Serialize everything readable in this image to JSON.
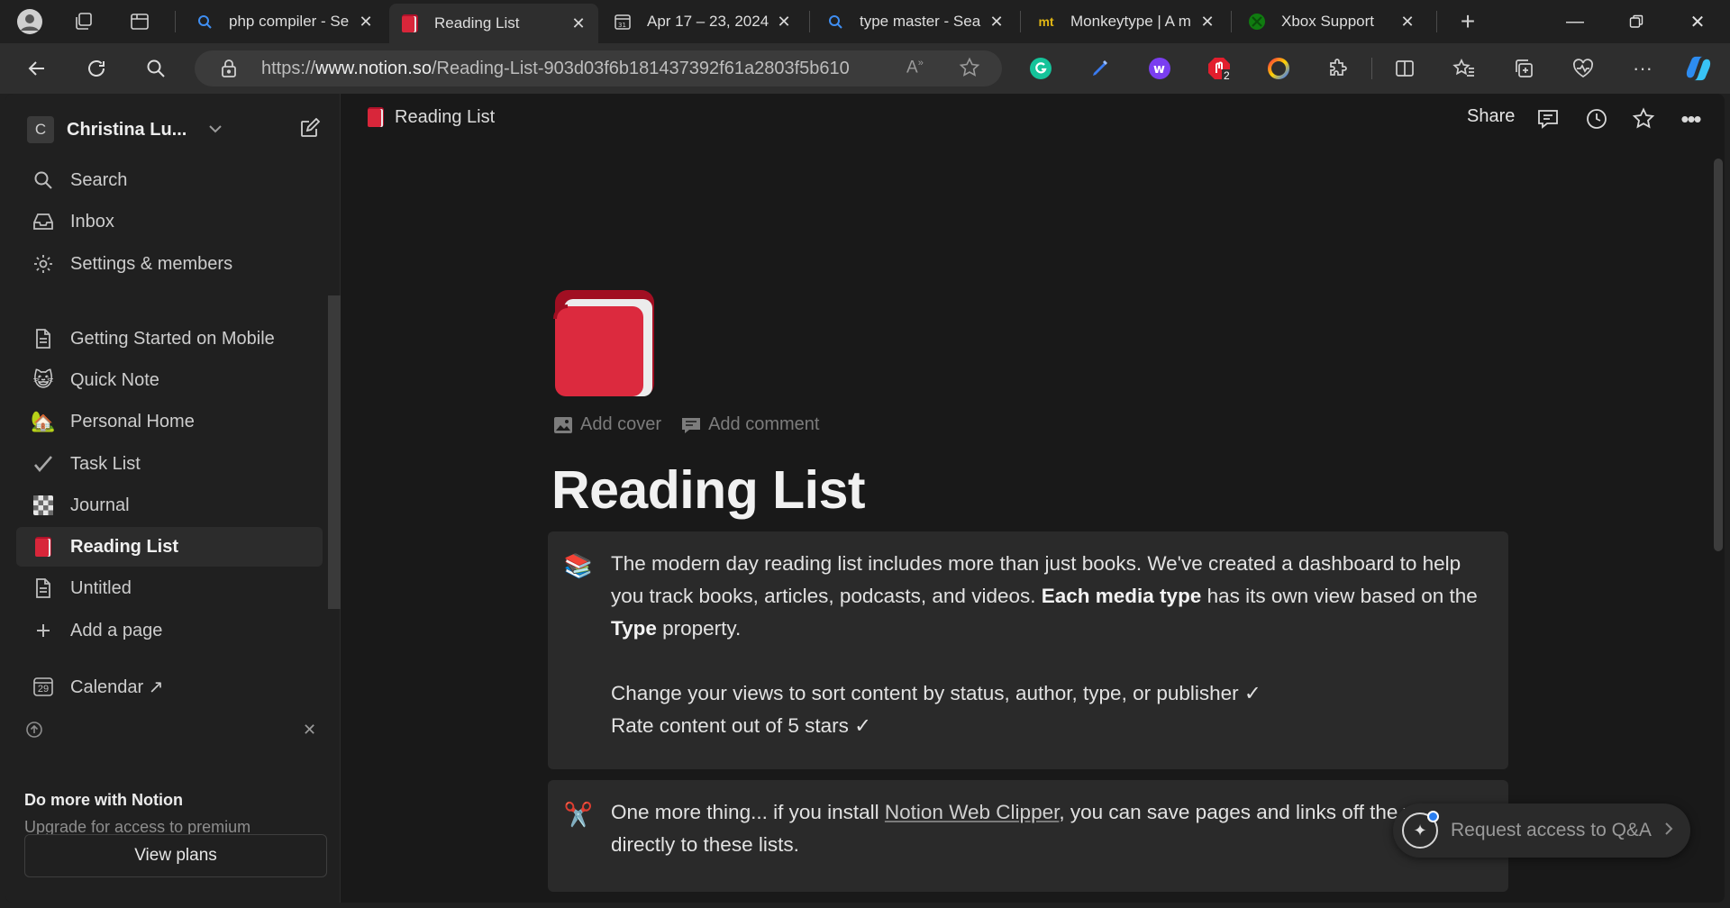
{
  "browser": {
    "tabs": [
      {
        "title": "php compiler - Se",
        "favicon": "search-icon"
      },
      {
        "title": "Reading List",
        "favicon": "red-book-icon",
        "active": true
      },
      {
        "title": "Apr 17 – 23, 2024",
        "favicon": "calendar-icon"
      },
      {
        "title": "type master - Sea",
        "favicon": "search-icon"
      },
      {
        "title": "Monkeytype | A m",
        "favicon": "mt"
      },
      {
        "title": "Xbox Support",
        "favicon": "xbox-icon"
      }
    ],
    "url_prefix": "https://",
    "url_domain": "www.notion.so",
    "url_path": "/Reading-List-903d03f6b181437392f61a2803f5b610",
    "extension_badge": "2"
  },
  "sidebar": {
    "workspace_initial": "C",
    "workspace_name": "Christina Lu...",
    "items": [
      {
        "label": "Search",
        "icon": "search-icon"
      },
      {
        "label": "Inbox",
        "icon": "inbox-icon"
      },
      {
        "label": "Settings & members",
        "icon": "gear-icon"
      },
      {
        "label": "Getting Started on Mobile",
        "icon": "page-icon"
      },
      {
        "label": "Quick Note",
        "icon": "😺"
      },
      {
        "label": "Personal Home",
        "icon": "🏡"
      },
      {
        "label": "Task List",
        "icon": "✔️"
      },
      {
        "label": "Journal",
        "icon": "checker-icon"
      },
      {
        "label": "Reading List",
        "icon": "📕"
      },
      {
        "label": "Untitled",
        "icon": "page-icon"
      },
      {
        "label": "Add a page",
        "icon": "plus-icon"
      },
      {
        "label": "Calendar ↗",
        "icon": "calendar-icon"
      }
    ],
    "calendar_day": "29",
    "promo": {
      "title": "Do more with Notion",
      "description": "Upgrade for access to premium features.",
      "button": "View plans"
    }
  },
  "topbar": {
    "breadcrumb": "Reading List",
    "share_label": "Share"
  },
  "page": {
    "add_cover": "Add cover",
    "add_comment": "Add comment",
    "title": "Reading List",
    "callout1": {
      "emoji": "📚",
      "p1_a": "The modern day reading list includes more than just books. We've created a dashboard to help you track books, articles, podcasts, and videos. ",
      "p1_b": "Each media type",
      "p1_c": " has its own view based on the ",
      "p1_d": "Type",
      "p1_e": " property.",
      "line2": "Change your views to sort content by status, author, type, or publisher ✓",
      "line3": "Rate content out of 5 stars ✓"
    },
    "callout2": {
      "emoji": "✂️",
      "a": "One more thing... if you install ",
      "link": "Notion Web Clipper",
      "b": ", you can save pages and links off the web directly to these lists."
    },
    "qa_label": "Request access to Q&A"
  },
  "colors": {
    "accent_blue": "#2a7ef0",
    "book_red": "#d8263a"
  }
}
